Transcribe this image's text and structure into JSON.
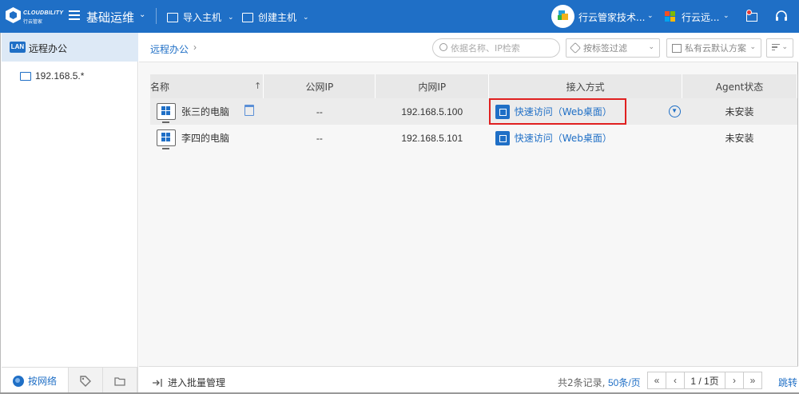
{
  "brand": {
    "name": "CLOUDBILITY",
    "sub": "行云管家"
  },
  "header": {
    "module_title": "基础运维",
    "import_host": "导入主机",
    "create_host": "创建主机",
    "org_name": "行云管家技术...",
    "workspace": "行云远..."
  },
  "sidebar": {
    "root_badge": "LAN",
    "root_label": "远程办公",
    "child_label": "192.168.5.*",
    "tabs": {
      "network": "按网络"
    }
  },
  "toolbar": {
    "breadcrumb": "远程办公",
    "search_placeholder": "依据名称、IP检索",
    "tag_filter": "按标签过滤",
    "plan_filter": "私有云默认方案"
  },
  "table": {
    "columns": [
      "名称",
      "公网IP",
      "内网IP",
      "接入方式",
      "Agent状态"
    ],
    "rows": [
      {
        "name": "张三的电脑",
        "public_ip": "--",
        "private_ip": "192.168.5.100",
        "access": "快速访问（Web桌面）",
        "agent": "未安装"
      },
      {
        "name": "李四的电脑",
        "public_ip": "--",
        "private_ip": "192.168.5.101",
        "access": "快速访问（Web桌面）",
        "agent": "未安装"
      }
    ]
  },
  "footer": {
    "batch": "进入批量管理",
    "total": "共2条记录,",
    "per_page": "50条/页",
    "first": "«",
    "prev": "‹",
    "page": "1 / 1页",
    "next": "›",
    "last": "»",
    "jump": "跳转"
  },
  "colors": {
    "primary": "#1f6fc6",
    "highlight": "#e02020"
  }
}
